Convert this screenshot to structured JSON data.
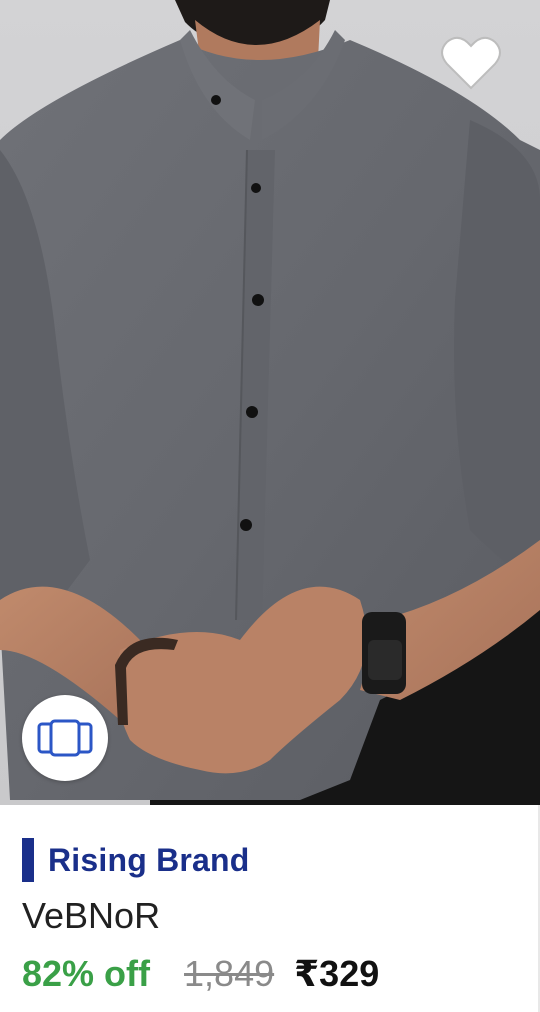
{
  "product_card": {
    "image_alt": "",
    "wishlist_icon": "heart-outline-icon",
    "gallery_icon": "image-stack-icon",
    "brand_badge": {
      "label": "Rising Brand",
      "color": "#1a2f8a",
      "bar_color": "#1a2f8a"
    },
    "product_name": "VeBNoR",
    "discount": "82% off",
    "discount_color": "#3aa047",
    "mrp": "1,849",
    "price": "₹329"
  }
}
